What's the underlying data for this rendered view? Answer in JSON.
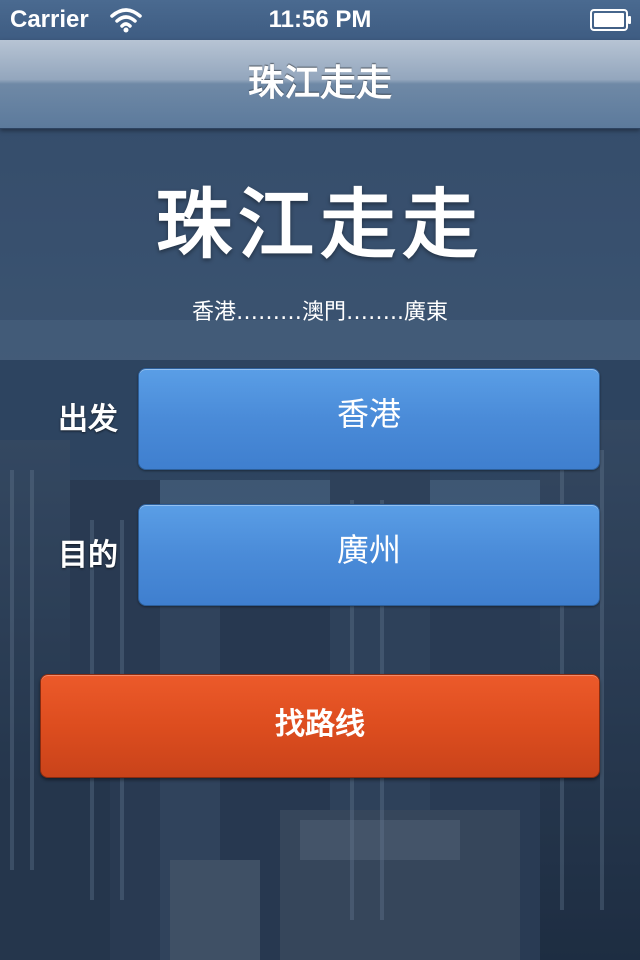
{
  "status_bar": {
    "carrier": "Carrier",
    "time": "11:56 PM",
    "wifi_icon": "wifi-icon",
    "battery_icon": "battery-icon"
  },
  "nav": {
    "title": "珠江走走"
  },
  "hero": {
    "title": "珠江走走",
    "subtitle": "香港………澳門……..廣東"
  },
  "form": {
    "origin": {
      "label": "出发",
      "value": "香港"
    },
    "destination": {
      "label": "目的",
      "value": "廣州"
    },
    "search_label": "找路线"
  },
  "colors": {
    "field_blue": "#4a8bd8",
    "search_orange": "#dd4d1f",
    "nav_gradient_top": "#b7c4d4",
    "nav_gradient_bottom": "#5c7a9c"
  }
}
